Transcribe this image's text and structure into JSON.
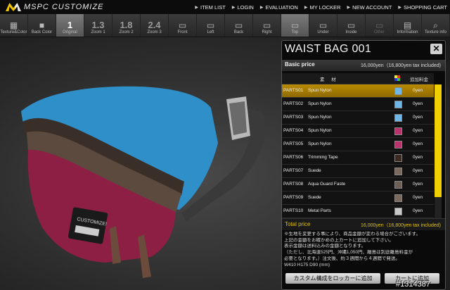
{
  "logo": {
    "text": "MSPC CUSTOMIZE"
  },
  "nav": [
    {
      "label": "ITEM LIST"
    },
    {
      "label": "LOGIN"
    },
    {
      "label": "EVALUATION"
    },
    {
      "label": "MY LOCKER"
    },
    {
      "label": "NEW ACCOUNT"
    },
    {
      "label": "SHOPPING CART"
    }
  ],
  "toolbar": [
    {
      "label": "Texture&Color",
      "icon": "palette-icon",
      "glyph": "▦"
    },
    {
      "label": "Back Color",
      "icon": "back-color-icon",
      "glyph": "■"
    },
    {
      "label": "Original",
      "num": "1"
    },
    {
      "label": "Zoom 1",
      "num": "1.3"
    },
    {
      "label": "Zoom 2",
      "num": "1.8"
    },
    {
      "label": "Zoom 3",
      "num": "2.4"
    },
    {
      "label": "Front",
      "icon": "view-front-icon",
      "glyph": "▭"
    },
    {
      "label": "Left",
      "icon": "view-left-icon",
      "glyph": "▭"
    },
    {
      "label": "Back",
      "icon": "view-back-icon",
      "glyph": "▭"
    },
    {
      "label": "Right",
      "icon": "view-right-icon",
      "glyph": "▭"
    },
    {
      "label": "Top",
      "icon": "view-top-icon",
      "glyph": "▭"
    },
    {
      "label": "Under",
      "icon": "view-under-icon",
      "glyph": "▭"
    },
    {
      "label": "Inside",
      "icon": "view-inside-icon",
      "glyph": "▭"
    },
    {
      "label": "Other",
      "icon": "view-other-icon",
      "glyph": "▭"
    },
    {
      "label": "Information",
      "icon": "info-icon",
      "glyph": "▤"
    },
    {
      "label": "Texture info",
      "icon": "magnifier-icon",
      "glyph": "⌕"
    }
  ],
  "panel": {
    "title": "WAIST BAG 001",
    "basic_label": "Basic price",
    "basic_value": "16,000yen（16,800yen tax included)",
    "col_material": "素 材",
    "col_fee": "追加料金",
    "parts": [
      {
        "code": "PARTS01",
        "material": "Spun Nylon",
        "color": "#6fb6e6",
        "fee": "0yen"
      },
      {
        "code": "PARTS02",
        "material": "Spun Nylon",
        "color": "#6fb6e6",
        "fee": "0yen"
      },
      {
        "code": "PARTS03",
        "material": "Spun Nylon",
        "color": "#6fb6e6",
        "fee": "0yen"
      },
      {
        "code": "PARTS04",
        "material": "Spun Nylon",
        "color": "#b8336a",
        "fee": "0yen"
      },
      {
        "code": "PARTS05",
        "material": "Spun Nylon",
        "color": "#b8336a",
        "fee": "0yen"
      },
      {
        "code": "PARTS06",
        "material": "Trimming Tape",
        "color": "#3a2a22",
        "fee": "0yen"
      },
      {
        "code": "PARTS07",
        "material": "Suede",
        "color": "#7a6a5e",
        "fee": "0yen"
      },
      {
        "code": "PARTS08",
        "material": "Aqua Guard Faste",
        "color": "#6a6058",
        "fee": "0yen"
      },
      {
        "code": "PARTS09",
        "material": "Suede",
        "color": "#7a6a5e",
        "fee": "0yen"
      },
      {
        "code": "PARTS10",
        "material": "Metal Parts",
        "color": "#c8c8c8",
        "fee": "0yen"
      }
    ],
    "total_label": "Total price",
    "total_value": "16,000yen（16,800yen tax included)",
    "notes": [
      "※生地を変更する事により、商品金額が変わる場合がございます。",
      "上記の金額をお確かめの上カートに追加して下さい。",
      "表示金額は送料込みの金額となります。",
      "（ただし、北海道525円、沖縄1,050円、離島は別途離島料金が",
      "必要となります。）注文後、約３週間から４週間で発送。",
      "W410 H175 D90 (mm)"
    ],
    "btn_locker": "カスタム構成をロッカーに追加",
    "btn_cart": "カートに追加"
  },
  "watermark": "#1314387",
  "colors": {
    "accent": "#f0d000",
    "selected_row": "#a07800",
    "bag_blue": "#2f8fc8",
    "bag_wine": "#8e1f44"
  }
}
